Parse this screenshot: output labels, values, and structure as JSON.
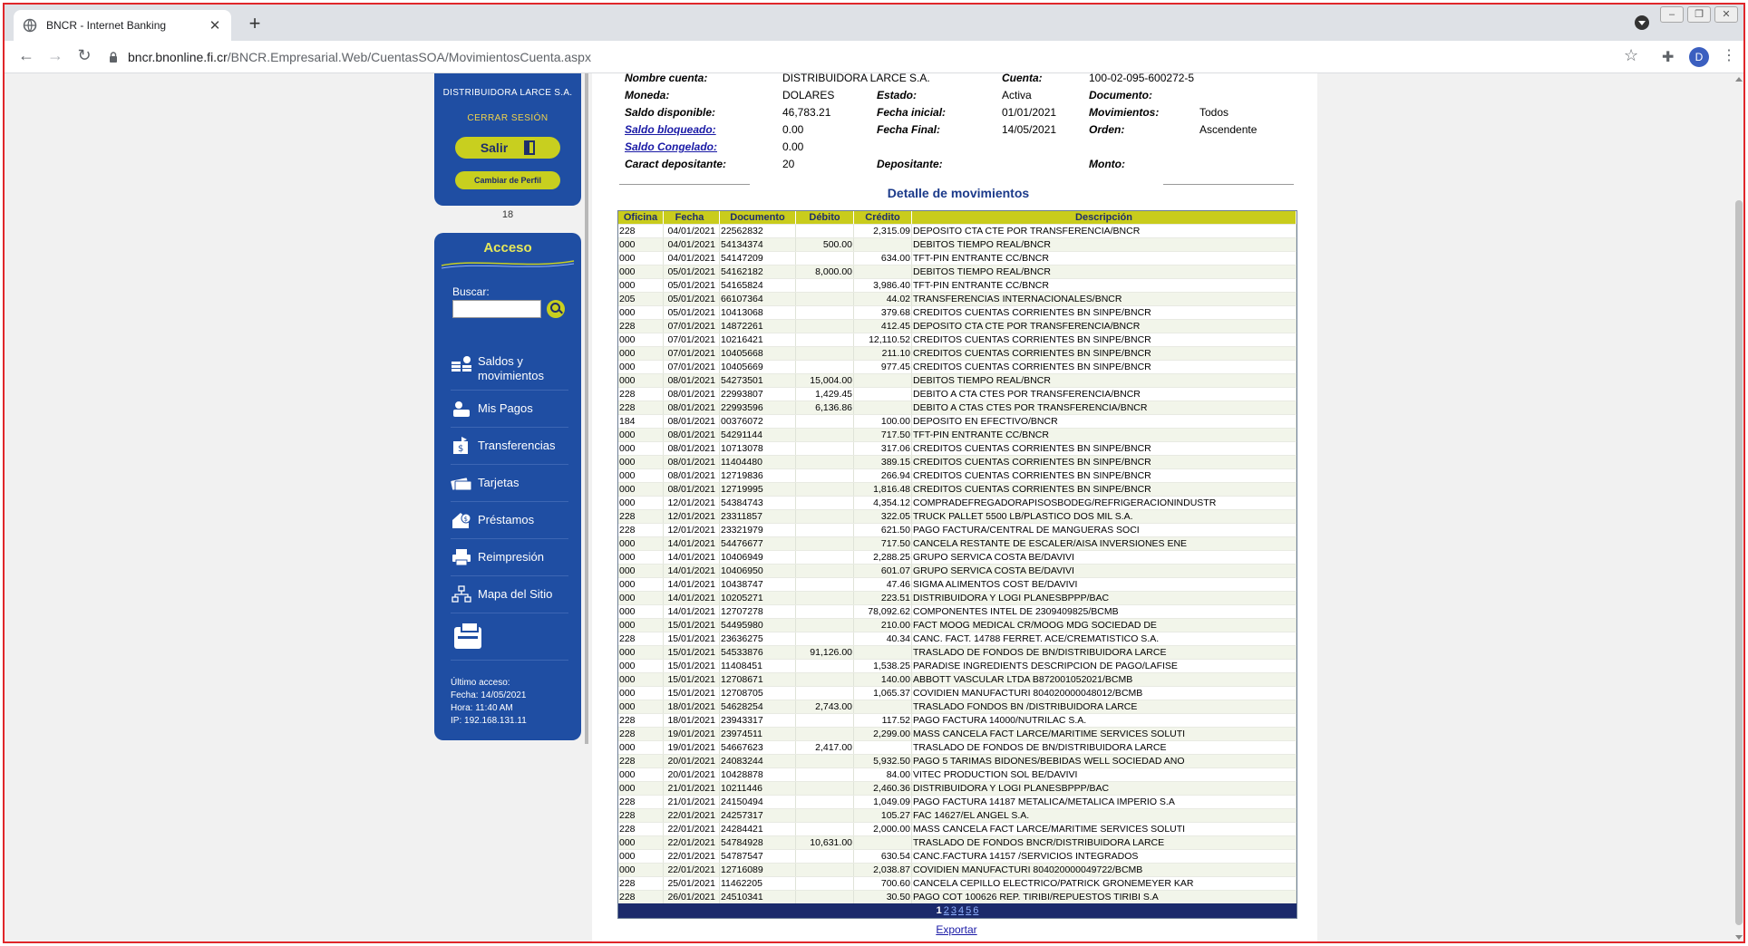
{
  "browser": {
    "tab_title": "BNCR - Internet Banking",
    "url_host": "bncr.bnonline.fi.cr",
    "url_path": "/BNCR.Empresarial.Web/CuentasSOA/MovimientosCuenta.aspx",
    "profile_initial": "D"
  },
  "sidebar": {
    "company": "DISTRIBUIDORA LARCE S.A.",
    "logout": "CERRAR SESIÓN",
    "salir": "Salir",
    "cambiar_perfil": "Cambiar de Perfil",
    "number": "18",
    "acceso_title": "Acceso",
    "search_label": "Buscar:",
    "menu": [
      {
        "label": "Saldos y movimientos",
        "icon": "coins-icon"
      },
      {
        "label": "Mis Pagos",
        "icon": "payments-icon"
      },
      {
        "label": "Transferencias",
        "icon": "transfer-icon"
      },
      {
        "label": "Tarjetas",
        "icon": "cards-icon"
      },
      {
        "label": "Préstamos",
        "icon": "loan-icon"
      },
      {
        "label": "Reimpresión",
        "icon": "printer-icon"
      },
      {
        "label": "Mapa del Sitio",
        "icon": "sitemap-icon"
      }
    ],
    "last_access": {
      "title": "Último acceso:",
      "fecha": "Fecha: 14/05/2021",
      "hora": "Hora: 11:40 AM",
      "ip": "IP: 192.168.131.11"
    }
  },
  "account": {
    "nombre_label": "Nombre cuenta:",
    "nombre_value": "DISTRIBUIDORA LARCE S.A.",
    "cuenta_label": "Cuenta:",
    "cuenta_value": "100-02-095-600272-5",
    "moneda_label": "Moneda:",
    "moneda_value": "DOLARES",
    "estado_label": "Estado:",
    "estado_value": "Activa",
    "documento_label": "Documento:",
    "saldo_disp_label": "Saldo disponible:",
    "saldo_disp_value": "46,783.21",
    "fecha_ini_label": "Fecha inicial:",
    "fecha_ini_value": "01/01/2021",
    "movimientos_label": "Movimientos:",
    "movimientos_value": "Todos",
    "saldo_bloq_label": "Saldo bloqueado:",
    "saldo_bloq_value": "0.00",
    "fecha_fin_label": "Fecha Final:",
    "fecha_fin_value": "14/05/2021",
    "orden_label": "Orden:",
    "orden_value": "Ascendente",
    "saldo_cong_label": "Saldo Congelado:",
    "saldo_cong_value": "0.00",
    "caract_label": "Caract depositante:",
    "caract_value": "20",
    "depositante_label": "Depositante:",
    "monto_label": "Monto:"
  },
  "detail_title": "Detalle de movimientos",
  "table": {
    "headers": [
      "Oficina",
      "Fecha",
      "Documento",
      "Débito",
      "Crédito",
      "Descripción"
    ],
    "rows": [
      [
        "228",
        "04/01/2021",
        "22562832",
        "",
        "2,315.09",
        "DEPOSITO CTA CTE POR TRANSFERENCIA/BNCR"
      ],
      [
        "000",
        "04/01/2021",
        "54134374",
        "500.00",
        "",
        "DEBITOS TIEMPO REAL/BNCR"
      ],
      [
        "000",
        "04/01/2021",
        "54147209",
        "",
        "634.00",
        "TFT-PIN ENTRANTE CC/BNCR"
      ],
      [
        "000",
        "05/01/2021",
        "54162182",
        "8,000.00",
        "",
        "DEBITOS TIEMPO REAL/BNCR"
      ],
      [
        "000",
        "05/01/2021",
        "54165824",
        "",
        "3,986.40",
        "TFT-PIN ENTRANTE CC/BNCR"
      ],
      [
        "205",
        "05/01/2021",
        "66107364",
        "",
        "44.02",
        "TRANSFERENCIAS INTERNACIONALES/BNCR"
      ],
      [
        "000",
        "05/01/2021",
        "10413068",
        "",
        "379.68",
        "CREDITOS CUENTAS CORRIENTES BN SINPE/BNCR"
      ],
      [
        "228",
        "07/01/2021",
        "14872261",
        "",
        "412.45",
        "DEPOSITO CTA CTE POR TRANSFERENCIA/BNCR"
      ],
      [
        "000",
        "07/01/2021",
        "10216421",
        "",
        "12,110.52",
        "CREDITOS CUENTAS CORRIENTES BN SINPE/BNCR"
      ],
      [
        "000",
        "07/01/2021",
        "10405668",
        "",
        "211.10",
        "CREDITOS CUENTAS CORRIENTES BN SINPE/BNCR"
      ],
      [
        "000",
        "07/01/2021",
        "10405669",
        "",
        "977.45",
        "CREDITOS CUENTAS CORRIENTES BN SINPE/BNCR"
      ],
      [
        "000",
        "08/01/2021",
        "54273501",
        "15,004.00",
        "",
        "DEBITOS TIEMPO REAL/BNCR"
      ],
      [
        "228",
        "08/01/2021",
        "22993807",
        "1,429.45",
        "",
        "DEBITO A CTA CTES POR TRANSFERENCIA/BNCR"
      ],
      [
        "228",
        "08/01/2021",
        "22993596",
        "6,136.86",
        "",
        "DEBITO A CTAS CTES POR TRANSFERENCIA/BNCR"
      ],
      [
        "184",
        "08/01/2021",
        "00376072",
        "",
        "100.00",
        "DEPOSITO EN EFECTIVO/BNCR"
      ],
      [
        "000",
        "08/01/2021",
        "54291144",
        "",
        "717.50",
        "TFT-PIN ENTRANTE CC/BNCR"
      ],
      [
        "000",
        "08/01/2021",
        "10713078",
        "",
        "317.06",
        "CREDITOS CUENTAS CORRIENTES BN SINPE/BNCR"
      ],
      [
        "000",
        "08/01/2021",
        "11404480",
        "",
        "389.15",
        "CREDITOS CUENTAS CORRIENTES BN SINPE/BNCR"
      ],
      [
        "000",
        "08/01/2021",
        "12719836",
        "",
        "266.94",
        "CREDITOS CUENTAS CORRIENTES BN SINPE/BNCR"
      ],
      [
        "000",
        "08/01/2021",
        "12719995",
        "",
        "1,816.48",
        "CREDITOS CUENTAS CORRIENTES BN SINPE/BNCR"
      ],
      [
        "000",
        "12/01/2021",
        "54384743",
        "",
        "4,354.12",
        "COMPRADEFREGADORAPISOSBODEG/REFRIGERACIONINDUSTR"
      ],
      [
        "228",
        "12/01/2021",
        "23311857",
        "",
        "322.05",
        "TRUCK PALLET 5500 LB/PLASTICO DOS MIL S.A."
      ],
      [
        "228",
        "12/01/2021",
        "23321979",
        "",
        "621.50",
        "PAGO FACTURA/CENTRAL DE MANGUERAS SOCI"
      ],
      [
        "000",
        "14/01/2021",
        "54476677",
        "",
        "717.50",
        "CANCELA RESTANTE DE ESCALER/AISA INVERSIONES ENE"
      ],
      [
        "000",
        "14/01/2021",
        "10406949",
        "",
        "2,288.25",
        "GRUPO SERVICA COSTA BE/DAVIVI"
      ],
      [
        "000",
        "14/01/2021",
        "10406950",
        "",
        "601.07",
        "GRUPO SERVICA COSTA BE/DAVIVI"
      ],
      [
        "000",
        "14/01/2021",
        "10438747",
        "",
        "47.46",
        "SIGMA ALIMENTOS COST BE/DAVIVI"
      ],
      [
        "000",
        "14/01/2021",
        "10205271",
        "",
        "223.51",
        "DISTRIBUIDORA Y LOGI PLANESBPPP/BAC"
      ],
      [
        "000",
        "14/01/2021",
        "12707278",
        "",
        "78,092.62",
        "COMPONENTES INTEL DE 2309409825/BCMB"
      ],
      [
        "000",
        "15/01/2021",
        "54495980",
        "",
        "210.00",
        "FACT MOOG MEDICAL CR/MOOG MDG SOCIEDAD DE"
      ],
      [
        "228",
        "15/01/2021",
        "23636275",
        "",
        "40.34",
        "CANC. FACT. 14788 FERRET. ACE/CREMATISTICO S.A."
      ],
      [
        "000",
        "15/01/2021",
        "54533876",
        "91,126.00",
        "",
        "TRASLADO DE FONDOS DE BN/DISTRIBUIDORA LARCE"
      ],
      [
        "000",
        "15/01/2021",
        "11408451",
        "",
        "1,538.25",
        "PARADISE INGREDIENTS DESCRIPCION DE PAGO/LAFISE"
      ],
      [
        "000",
        "15/01/2021",
        "12708671",
        "",
        "140.00",
        "ABBOTT VASCULAR LTDA B872001052021/BCMB"
      ],
      [
        "000",
        "15/01/2021",
        "12708705",
        "",
        "1,065.37",
        "COVIDIEN MANUFACTURI 804020000048012/BCMB"
      ],
      [
        "000",
        "18/01/2021",
        "54628254",
        "2,743.00",
        "",
        "TRASLADO FONDOS BN /DISTRIBUIDORA LARCE"
      ],
      [
        "228",
        "18/01/2021",
        "23943317",
        "",
        "117.52",
        "PAGO FACTURA 14000/NUTRILAC S.A."
      ],
      [
        "228",
        "19/01/2021",
        "23974511",
        "",
        "2,299.00",
        "MASS CANCELA FACT LARCE/MARITIME SERVICES SOLUTI"
      ],
      [
        "000",
        "19/01/2021",
        "54667623",
        "2,417.00",
        "",
        "TRASLADO DE FONDOS DE BN/DISTRIBUIDORA LARCE"
      ],
      [
        "228",
        "20/01/2021",
        "24083244",
        "",
        "5,932.50",
        "PAGO 5 TARIMAS BIDONES/BEBIDAS WELL SOCIEDAD ANO"
      ],
      [
        "000",
        "20/01/2021",
        "10428878",
        "",
        "84.00",
        "VITEC PRODUCTION SOL BE/DAVIVI"
      ],
      [
        "000",
        "21/01/2021",
        "10211446",
        "",
        "2,460.36",
        "DISTRIBUIDORA Y LOGI PLANESBPPP/BAC"
      ],
      [
        "228",
        "21/01/2021",
        "24150494",
        "",
        "1,049.09",
        "PAGO FACTURA 14187 METALICA/METALICA IMPERIO S.A"
      ],
      [
        "228",
        "22/01/2021",
        "24257317",
        "",
        "105.27",
        "FAC 14627/EL ANGEL S.A."
      ],
      [
        "228",
        "22/01/2021",
        "24284421",
        "",
        "2,000.00",
        "MASS CANCELA FACT LARCE/MARITIME SERVICES SOLUTI"
      ],
      [
        "000",
        "22/01/2021",
        "54784928",
        "10,631.00",
        "",
        "TRASLADO DE FONDOS BNCR/DISTRIBUIDORA LARCE"
      ],
      [
        "000",
        "22/01/2021",
        "54787547",
        "",
        "630.54",
        "CANC.FACTURA 14157 /SERVICIOS INTEGRADOS"
      ],
      [
        "000",
        "22/01/2021",
        "12716089",
        "",
        "2,038.87",
        "COVIDIEN MANUFACTURI 804020000049722/BCMB"
      ],
      [
        "228",
        "25/01/2021",
        "11462205",
        "",
        "700.60",
        "CANCELA CEPILLO ELECTRICO/PATRICK GRONEMEYER KAR"
      ],
      [
        "228",
        "26/01/2021",
        "24510341",
        "",
        "30.50",
        "PAGO COT 100626 REP. TIRIBI/REPUESTOS TIRIBI S.A"
      ]
    ],
    "pages": [
      "1",
      "2",
      "3",
      "4",
      "5",
      "6"
    ],
    "current_page": "1"
  },
  "exportar": "Exportar"
}
